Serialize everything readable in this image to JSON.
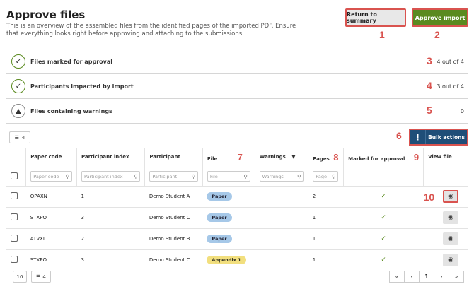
{
  "header": {
    "title": "Approve files",
    "description": "This is an overview of the assembled files from the identified pages of the imported PDF. Ensure that everything looks right before approving and attaching to the submissions.",
    "return_label": "Return to summary",
    "approve_label": "Approve import"
  },
  "summary": [
    {
      "label": "Files marked for approval",
      "value": "4 out of 4",
      "icon": "check-circle-icon"
    },
    {
      "label": "Participants impacted by import",
      "value": "3 out of 4",
      "icon": "check-circle-icon"
    },
    {
      "label": "Files containing warnings",
      "value": "0",
      "icon": "warning-icon"
    }
  ],
  "toolbar": {
    "column_count": "4",
    "bulk_label": "Bulk actions"
  },
  "table": {
    "columns": [
      "Paper code",
      "Participant index",
      "Participant",
      "File",
      "Warnings",
      "Pages",
      "Marked for approval",
      "View file"
    ],
    "filter_placeholders": [
      "Paper code",
      "Participant index",
      "Participant",
      "File",
      "Warnings",
      "Page"
    ],
    "rows": [
      {
        "paper_code": "OPAXN",
        "index": "1",
        "participant": "Demo Student A",
        "file": "Paper",
        "file_type": "paper",
        "warnings": "",
        "pages": "2",
        "approved": "✓"
      },
      {
        "paper_code": "STXPO",
        "index": "3",
        "participant": "Demo Student C",
        "file": "Paper",
        "file_type": "paper",
        "warnings": "",
        "pages": "1",
        "approved": "✓"
      },
      {
        "paper_code": "ATVXL",
        "index": "2",
        "participant": "Demo Student B",
        "file": "Paper",
        "file_type": "paper",
        "warnings": "",
        "pages": "1",
        "approved": "✓"
      },
      {
        "paper_code": "STXPO",
        "index": "3",
        "participant": "Demo Student C",
        "file": "Appendix 1",
        "file_type": "appendix",
        "warnings": "",
        "pages": "1",
        "approved": "✓"
      }
    ]
  },
  "footer": {
    "page_size": "10",
    "column_count": "4",
    "current_page": "1"
  },
  "markers": [
    "1",
    "2",
    "3",
    "4",
    "5",
    "6",
    "7",
    "8",
    "9",
    "10"
  ],
  "colors": {
    "approve": "#5a8a1f",
    "bulk": "#1f4e78",
    "marker": "#d9534f"
  }
}
